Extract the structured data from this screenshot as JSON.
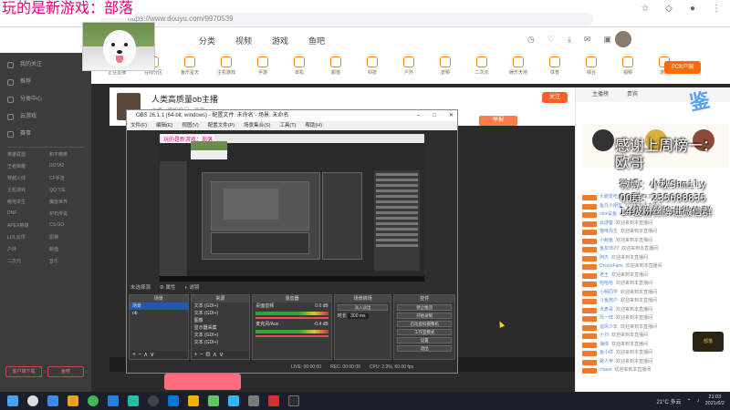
{
  "stream_overlay": {
    "title": "玩的是新游戏：部落",
    "thanks": "感谢上周榜一：",
    "thanks_name": "欧哥",
    "weibo": "微博：小秋Shmily",
    "qq": "QQ群：235688835",
    "fan_group": "14级粉丝牌进微信群"
  },
  "browser": {
    "url": "https://www.douyu.com/9970539"
  },
  "site_nav": {
    "menu": [
      "分类",
      "视频",
      "游戏",
      "鱼吧"
    ]
  },
  "categories": [
    "正在直播",
    "在线分区",
    "鱼乐星天",
    "主机游戏",
    "手游",
    "单机",
    "颜值",
    "科技",
    "户外",
    "音频",
    "二次元",
    "娱乐天地",
    "体育",
    "综合",
    "视频",
    "游戏"
  ],
  "pcb_label": "PCB户端",
  "sidebar": {
    "items": [
      "我的关注",
      "推荐",
      "分类中心",
      "云游戏",
      "赛事"
    ],
    "grid": [
      "英雄联盟",
      "和平精英",
      "王者荣耀",
      "DOTA2",
      "穿越火线",
      "CF手游",
      "主机游戏",
      "QQ飞车",
      "绝地求生",
      "魔兽世界",
      "DNF",
      "炉石传说",
      "APEX英雄",
      "CS:GO",
      "LOL云顶",
      "原神",
      "户外",
      "颜值",
      "二次元",
      "音乐"
    ],
    "bottom": [
      "客户端下载",
      "鱼吧"
    ]
  },
  "streamer": {
    "name": "人类高质量ob主播",
    "sub": "主播 · 单机热门 · 部落",
    "follow": "关注",
    "report": "举报"
  },
  "obs": {
    "title": "OBS 26.1.1 (64-bit, windows) - 配置文件: 未命名 - 场景: 未命名",
    "menu": [
      "文件(F)",
      "编辑(E)",
      "视图(V)",
      "配置文件(P)",
      "场景集合(S)",
      "工具(T)",
      "帮助(H)"
    ],
    "toolbar": [
      "未选择源",
      "属性",
      "滤镜"
    ],
    "panels": {
      "scenes_header": "场景",
      "scenes": [
        "场景",
        "ob"
      ],
      "sources_header": "来源",
      "sources": [
        "文本 (GDI+)",
        "文本 (GDI+)",
        "图像",
        "显示器采集",
        "文本 (GDI+)",
        "文本 (GDI+)"
      ],
      "mixer_header": "混音器",
      "mixer": [
        "桌面音频",
        "麦克风/Aux"
      ],
      "mixer_db": [
        "0.0 dB",
        "-0.4 dB"
      ],
      "transitions_header": "场景转场",
      "transition_type": "淡入淡出",
      "duration_label": "时长",
      "duration": "300 ms",
      "controls_header": "控件",
      "controls": [
        "停止推流",
        "开始录制",
        "启动虚拟摄像机",
        "工作室模式",
        "设置",
        "退出"
      ]
    },
    "status": [
      "LIVE: 00:00:00",
      "REC: 00:00:00",
      "CPU: 2.9%, 60.00 fps"
    ]
  },
  "chat": {
    "tabs": [
      "主播榜",
      "贵宾"
    ],
    "lines": [
      "欢迎来到本直播间",
      "欢迎来到本直播间",
      "欢迎来到本直播间",
      "欢迎来到本直播间",
      "欢迎来到本直播间",
      "欢迎来到本直播间",
      "欢迎来到本直播间",
      "欢迎来到本直播间",
      "欢迎来到本直播间",
      "欢迎来到本直播间",
      "欢迎来到本直播间",
      "欢迎来到本直播间",
      "欢迎来到本直播间",
      "欢迎来到本直播间",
      "欢迎来到本直播间",
      "欢迎来到本直播间",
      "欢迎来到本直播间",
      "欢迎来到本直播间",
      "欢迎来到本直播间",
      "欢迎来到本直播间",
      "欢迎来到本直播间"
    ],
    "users": [
      "大鹏爱吃鱼",
      "鱼丸小朋友",
      "nice鲨鱼",
      "云游客",
      "猫咪先生",
      "小鲸鱼",
      "鱼友9527",
      "阿杰",
      "DouyuFans",
      "老王",
      "哈哈哈",
      "小明同学",
      "斗鱼用户",
      "大表哥",
      "风一样",
      "追风少年",
      "小刘",
      "海绵",
      "鱼小样",
      "路人甲",
      "chase"
    ],
    "logo_text": "部落"
  },
  "taskbar": {
    "weather": "21°C 多云",
    "time": "21:03",
    "date": "2021/6/2"
  },
  "colors": {
    "accent": "#ff5d23",
    "overlay_pink": "#e6007a",
    "chat_name": "#5a8fd8"
  }
}
